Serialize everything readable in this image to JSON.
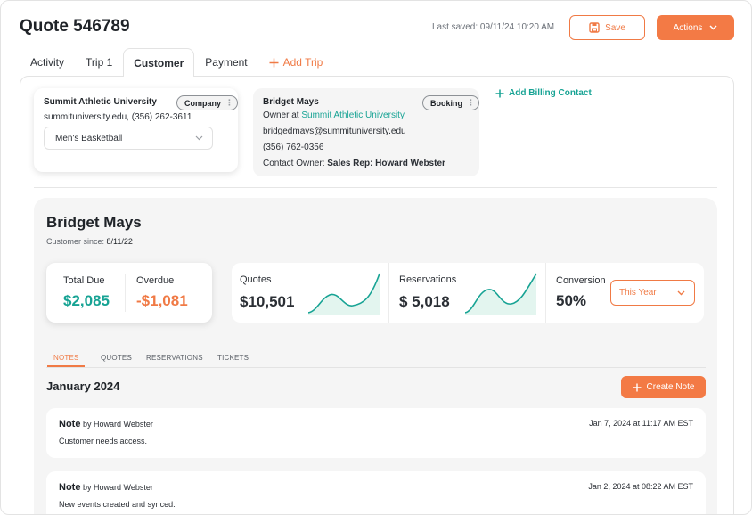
{
  "header": {
    "title": "Quote 546789",
    "last_saved": "Last saved: 09/11/24 10:20 AM",
    "save_label": "Save",
    "actions_label": "Actions"
  },
  "tabs": [
    {
      "label": "Activity"
    },
    {
      "label": "Trip 1"
    },
    {
      "label": "Customer",
      "active": true
    },
    {
      "label": "Payment"
    }
  ],
  "add_trip_label": "Add Trip",
  "company_card": {
    "name": "Summit Athletic University",
    "badge": "Company",
    "contact_line": "summituniversity.edu, (356) 262-3611",
    "team_select": "Men's Basketball"
  },
  "booking_card": {
    "name": "Bridget Mays",
    "badge": "Booking",
    "owner_prefix": "Owner at ",
    "owner_org": "Summit Athletic University",
    "email": "bridgedmays@summituniversity.edu",
    "phone": "(356) 762-0356",
    "contact_owner_label": "Contact Owner: ",
    "contact_owner_value": "Sales Rep: Howard Webster"
  },
  "add_billing_label": "Add Billing Contact",
  "summary": {
    "name": "Bridget Mays",
    "since_label": "Customer since: ",
    "since_value": "8/11/22",
    "total_due_label": "Total Due",
    "total_due_value": "$2,085",
    "overdue_label": "Overdue",
    "overdue_value": "-$1,081",
    "quotes_label": "Quotes",
    "quotes_value": "$10,501",
    "reservations_label": "Reservations",
    "reservations_value": "$ 5,018",
    "conversion_label": "Conversion",
    "conversion_value": "50%",
    "period_select": "This Year"
  },
  "subtabs": [
    {
      "label": "NOTES",
      "active": true
    },
    {
      "label": "QUOTES"
    },
    {
      "label": "RESERVATIONS"
    },
    {
      "label": "TICKETS"
    }
  ],
  "notes_section": {
    "month": "January 2024",
    "create_label": "Create Note",
    "notes": [
      {
        "title": "Note",
        "author": "by Howard Webster",
        "date": "Jan 7, 2024 at 11:17 AM EST",
        "body": "Customer needs access."
      },
      {
        "title": "Note",
        "author": "by Howard Webster",
        "date": "Jan 2, 2024 at 08:22 AM EST",
        "body": "New events created and synced."
      }
    ]
  },
  "colors": {
    "accent": "#f37a45",
    "teal": "#17a394",
    "surface": "#f5f5f5"
  }
}
